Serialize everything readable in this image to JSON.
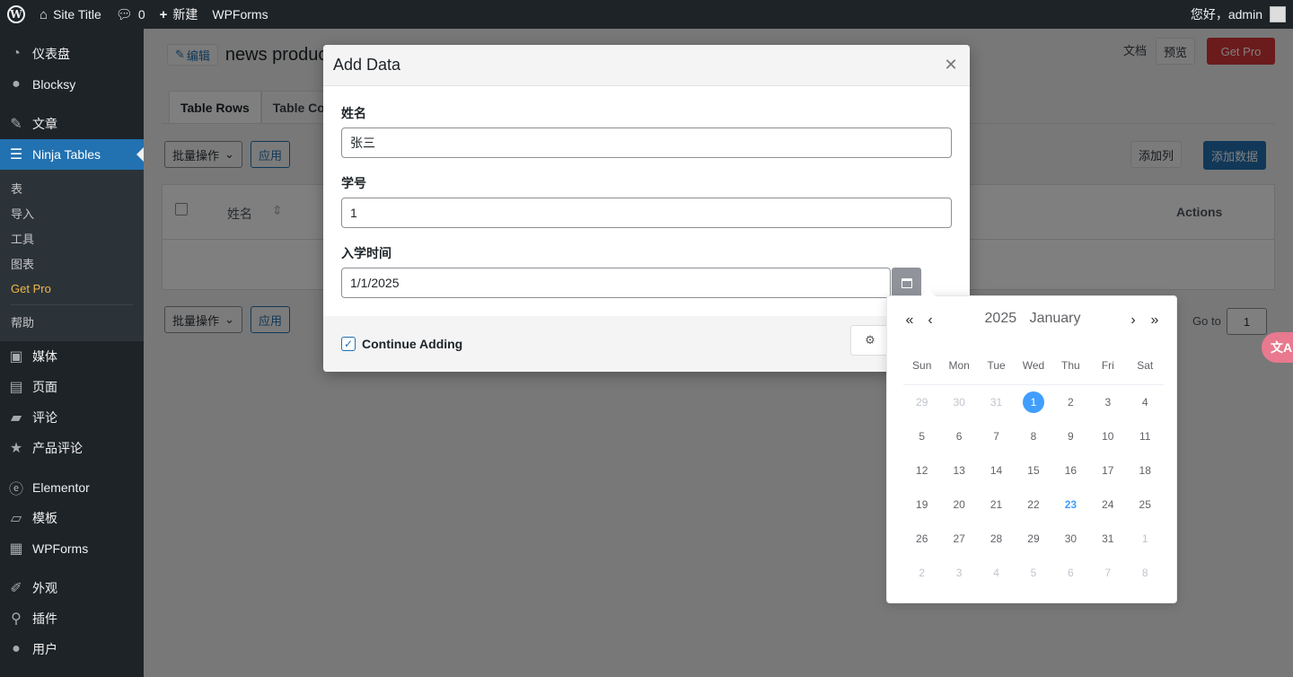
{
  "adminbar": {
    "site_title": "Site Title",
    "comments_count": "0",
    "new_label": "新建",
    "wpforms_label": "WPForms",
    "greeting": "您好，admin"
  },
  "sidebar": {
    "items_top": [
      {
        "label": "仪表盘",
        "icon": "dashboard-icon"
      },
      {
        "label": "Blocksy",
        "icon": "blocksy-icon"
      },
      {
        "label": "文章",
        "icon": "pin-icon"
      },
      {
        "label": "Ninja Tables",
        "icon": "table-icon"
      }
    ],
    "submenu": [
      "表",
      "导入",
      "工具",
      "图表",
      "Get Pro",
      "帮助"
    ],
    "items_bottom": [
      {
        "label": "媒体",
        "icon": "media-icon"
      },
      {
        "label": "页面",
        "icon": "page-icon"
      },
      {
        "label": "评论",
        "icon": "comment-icon"
      },
      {
        "label": "产品评论",
        "icon": "star-icon"
      },
      {
        "label": "Elementor",
        "icon": "elementor-icon"
      },
      {
        "label": "模板",
        "icon": "folder-icon"
      },
      {
        "label": "WPForms",
        "icon": "form-icon"
      },
      {
        "label": "外观",
        "icon": "brush-icon"
      },
      {
        "label": "插件",
        "icon": "plugin-icon"
      },
      {
        "label": "用户",
        "icon": "user-icon"
      }
    ]
  },
  "main": {
    "edit_label": "编辑",
    "table_name": "news produc",
    "docs_label": "文档",
    "preview_label": "预览",
    "getpro_label": "Get Pro",
    "tabs": [
      "Table Rows",
      "Table Co"
    ],
    "bulk_label": "批量操作",
    "apply_label": "应用",
    "add_column_label": "添加列",
    "add_data_label": "添加数据",
    "col_name": "姓名",
    "col_actions": "Actions",
    "goto_label": "Go to",
    "goto_value": "1"
  },
  "modal": {
    "title": "Add Data",
    "fields": [
      {
        "label": "姓名",
        "value": "张三"
      },
      {
        "label": "学号",
        "value": "1"
      },
      {
        "label": "入学时间",
        "value": "1/1/2025"
      }
    ],
    "continue_label": "Continue Adding"
  },
  "datepicker": {
    "year": "2025",
    "month": "January",
    "weekdays": [
      "Sun",
      "Mon",
      "Tue",
      "Wed",
      "Thu",
      "Fri",
      "Sat"
    ],
    "weeks": [
      [
        {
          "d": "29",
          "o": true
        },
        {
          "d": "30",
          "o": true
        },
        {
          "d": "31",
          "o": true
        },
        {
          "d": "1",
          "s": true
        },
        {
          "d": "2"
        },
        {
          "d": "3"
        },
        {
          "d": "4"
        }
      ],
      [
        {
          "d": "5"
        },
        {
          "d": "6"
        },
        {
          "d": "7"
        },
        {
          "d": "8"
        },
        {
          "d": "9"
        },
        {
          "d": "10"
        },
        {
          "d": "11"
        }
      ],
      [
        {
          "d": "12"
        },
        {
          "d": "13"
        },
        {
          "d": "14"
        },
        {
          "d": "15"
        },
        {
          "d": "16"
        },
        {
          "d": "17"
        },
        {
          "d": "18"
        }
      ],
      [
        {
          "d": "19"
        },
        {
          "d": "20"
        },
        {
          "d": "21"
        },
        {
          "d": "22"
        },
        {
          "d": "23",
          "t": true
        },
        {
          "d": "24"
        },
        {
          "d": "25"
        }
      ],
      [
        {
          "d": "26"
        },
        {
          "d": "27"
        },
        {
          "d": "28"
        },
        {
          "d": "29"
        },
        {
          "d": "30"
        },
        {
          "d": "31"
        },
        {
          "d": "1",
          "o": true
        }
      ],
      [
        {
          "d": "2",
          "o": true
        },
        {
          "d": "3",
          "o": true
        },
        {
          "d": "4",
          "o": true
        },
        {
          "d": "5",
          "o": true
        },
        {
          "d": "6",
          "o": true
        },
        {
          "d": "7",
          "o": true
        },
        {
          "d": "8",
          "o": true
        }
      ]
    ]
  },
  "translate_label": "文A"
}
